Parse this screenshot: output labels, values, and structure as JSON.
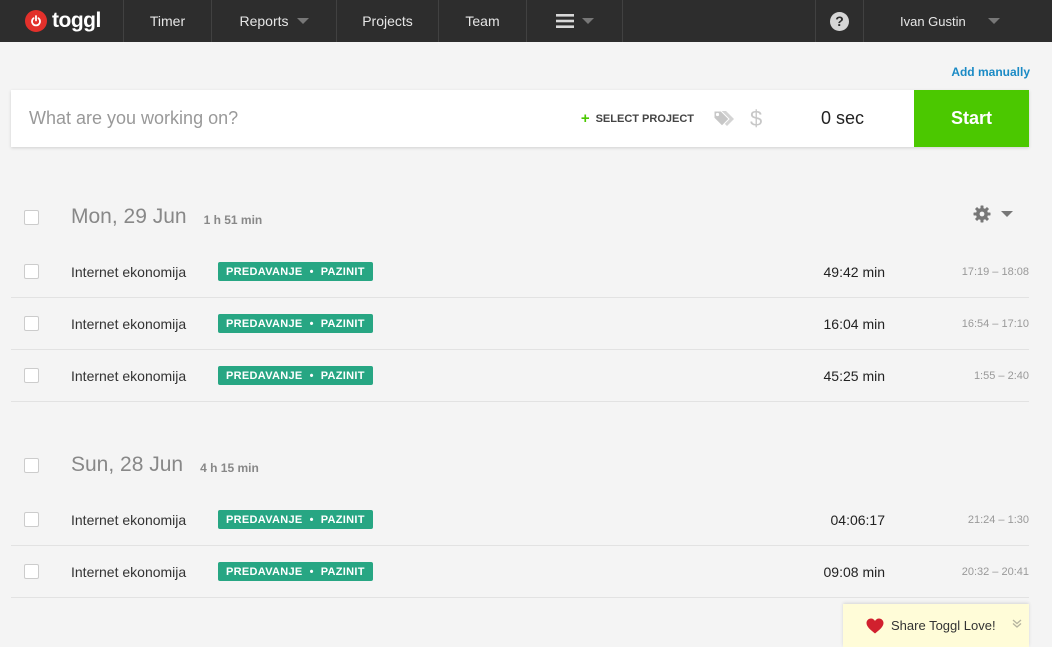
{
  "nav": {
    "logo_text": "toggl",
    "items": [
      {
        "label": "Timer"
      },
      {
        "label": "Reports"
      },
      {
        "label": "Projects"
      },
      {
        "label": "Team"
      }
    ],
    "help_icon": "?",
    "user_name": "Ivan Gustin"
  },
  "add_manually": "Add manually",
  "timer": {
    "placeholder": "What are you working on?",
    "select_project": "SELECT PROJECT",
    "currency_icon": "$",
    "duration": "0 sec",
    "start_label": "Start"
  },
  "days": [
    {
      "title": "Mon, 29 Jun",
      "total": "1 h 51 min",
      "entries": [
        {
          "description": "Internet ekonomija",
          "project": "PREDAVANJE",
          "client": "PAZINIT",
          "duration": "49:42 min",
          "range": "17:19 – 18:08"
        },
        {
          "description": "Internet ekonomija",
          "project": "PREDAVANJE",
          "client": "PAZINIT",
          "duration": "16:04 min",
          "range": "16:54 – 17:10"
        },
        {
          "description": "Internet ekonomija",
          "project": "PREDAVANJE",
          "client": "PAZINIT",
          "duration": "45:25 min",
          "range": "1:55 – 2:40"
        }
      ]
    },
    {
      "title": "Sun, 28 Jun",
      "total": "4 h 15 min",
      "entries": [
        {
          "description": "Internet ekonomija",
          "project": "PREDAVANJE",
          "client": "PAZINIT",
          "duration": "04:06:17",
          "range": "21:24 – 1:30"
        },
        {
          "description": "Internet ekonomija",
          "project": "PREDAVANJE",
          "client": "PAZINIT",
          "duration": "09:08 min",
          "range": "20:32 – 20:41"
        }
      ]
    }
  ],
  "share": {
    "label": "Share Toggl Love!"
  },
  "colors": {
    "nav_bg": "#2d2d2d",
    "brand_red": "#e2302b",
    "start_green": "#4bc800",
    "project_teal": "#27a683",
    "link_blue": "#1a8ac5"
  }
}
